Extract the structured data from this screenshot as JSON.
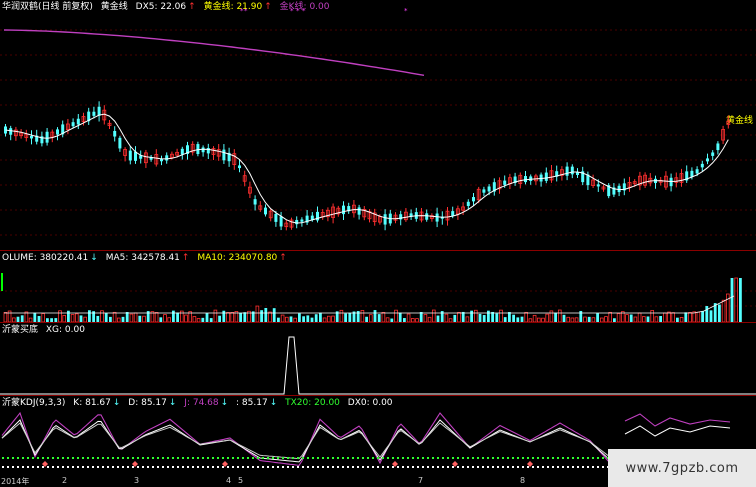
{
  "main": {
    "title": "华润双鹤(日线 前复权)",
    "indicator": "黄金线",
    "dx5": "DX5: 22.06",
    "gold_line": "黄金线: 21.90",
    "gold_k": "金K线: 0.00",
    "right_label": "黄金线"
  },
  "volume": {
    "vol": "OLUME: 380220.41",
    "ma5": "MA5: 342578.41",
    "ma10": "MA10: 234070.80"
  },
  "signal": {
    "label": "沂蒙买底",
    "xg": "XG: 0.00"
  },
  "kdj": {
    "label": "沂蒙KDJ(9,3,3)",
    "k": "K: 81.67",
    "d": "D: 85.17",
    "j": "J: 74.68",
    "extra": ": 85.17",
    "tx20": "TX20: 20.00",
    "dx0": "DX0: 0.00"
  },
  "dates": [
    "2014年",
    "2",
    "3",
    "4",
    "5",
    "7",
    "8"
  ],
  "watermark": "www.7gpzb.com",
  "colors": {
    "up": "#ff3030",
    "down": "#54ffff",
    "ma": "#ffffff",
    "gold": "#ffff00",
    "purple": "#c040c0",
    "separator": "#8b0000",
    "green": "#30ff30"
  }
}
